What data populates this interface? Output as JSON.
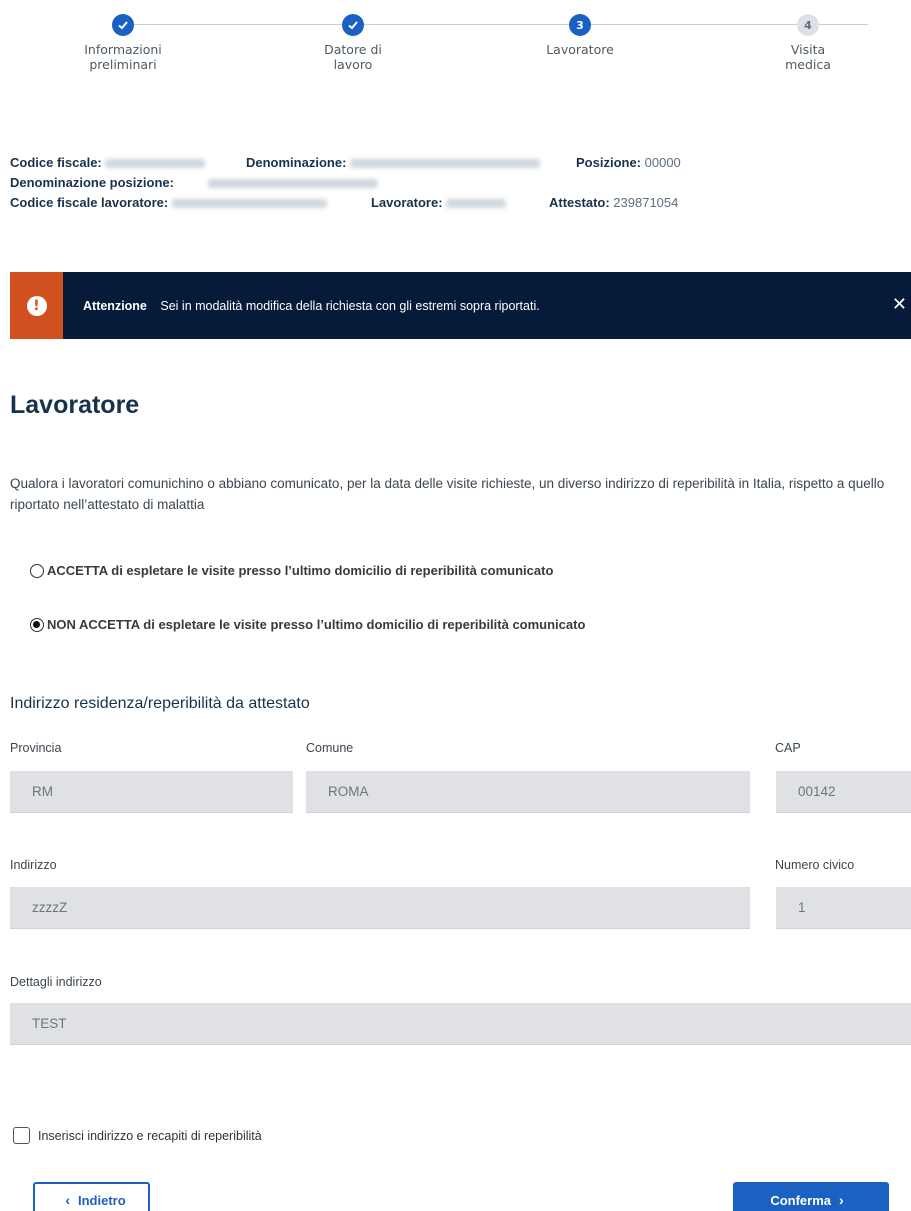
{
  "stepper": {
    "steps": [
      {
        "number": "",
        "label_line1": "Informazioni",
        "label_line2": "preliminari",
        "state": "done"
      },
      {
        "number": "",
        "label_line1": "Datore di",
        "label_line2": "lavoro",
        "state": "done"
      },
      {
        "number": "3",
        "label_line1": "Lavoratore",
        "label_line2": "",
        "state": "active"
      },
      {
        "number": "4",
        "label_line1": "Visita",
        "label_line2": "medica",
        "state": "todo"
      }
    ]
  },
  "summary": {
    "codice_fiscale_label": "Codice fiscale:",
    "denominazione_label": "Denominazione:",
    "posizione_label": "Posizione:",
    "posizione_value": "00000",
    "denominazione_posizione_label": "Denominazione posizione:",
    "codice_fiscale_lavoratore_label": "Codice fiscale lavoratore:",
    "lavoratore_label": "Lavoratore:",
    "attestato_label": "Attestato:",
    "attestato_value": "239871054"
  },
  "alert": {
    "title": "Attenzione",
    "message": "Sei in modalità modifica della richiesta con gli estremi sopra riportati.",
    "close_glyph": "✕",
    "color_bg": "#061b3a",
    "color_icon_bg": "#d1501f"
  },
  "section": {
    "title": "Lavoratore",
    "intro": "Qualora i lavoratori comunichino o abbiano comunicato, per la data delle visite richieste, un diverso indirizzo di reperibilità in Italia, rispetto a quello riportato nell’attestato di malattia"
  },
  "options": {
    "accetta": "ACCETTA di espletare le visite presso l’ultimo domicilio di reperibilità comunicato",
    "non_accetta": "NON ACCETTA di espletare le visite presso l’ultimo domicilio di reperibilità comunicato",
    "selected": "non_accetta"
  },
  "address": {
    "title": "Indirizzo residenza/reperibilità da attestato",
    "provincia_label": "Provincia",
    "provincia_value": "RM",
    "comune_label": "Comune",
    "comune_value": "ROMA",
    "cap_label": "CAP",
    "cap_value": "00142",
    "indirizzo_label": "Indirizzo",
    "indirizzo_value": "zzzzZ",
    "civico_label": "Numero civico",
    "civico_value": "1",
    "dettagli_label": "Dettagli indirizzo",
    "dettagli_value": "TEST"
  },
  "checkbox": {
    "label": "Inserisci indirizzo e recapiti di reperibilità",
    "checked": false
  },
  "buttons": {
    "back_label": "Indietro",
    "back_icon": "chevron-left-icon",
    "confirm_label": "Conferma",
    "confirm_icon": "chevron-right-icon",
    "accent": "#1b61c4"
  }
}
